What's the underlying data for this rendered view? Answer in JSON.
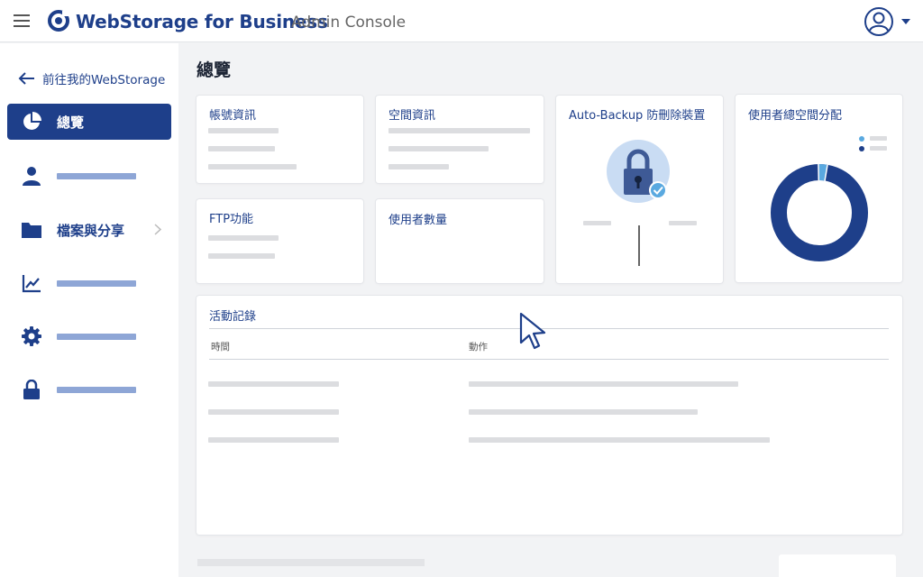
{
  "header": {
    "brand": "WebStorage for Business",
    "subtitle": "Admin Console",
    "menu_icon": "hamburger-icon",
    "logo_icon": "webstorage-logo-icon",
    "user_icon": "user-account-icon",
    "dropdown_icon": "caret-down-icon"
  },
  "sidebar": {
    "back_label": "前往我的WebStorage",
    "items": [
      {
        "label": "總覽",
        "icon": "pie-chart-icon",
        "active": true
      },
      {
        "label": "",
        "icon": "user-icon"
      },
      {
        "label": "檔案與分享",
        "icon": "folder-icon",
        "has_submenu": true
      },
      {
        "label": "",
        "icon": "line-chart-icon"
      },
      {
        "label": "",
        "icon": "gear-icon"
      },
      {
        "label": "",
        "icon": "lock-icon"
      }
    ]
  },
  "main": {
    "title": "總覽",
    "cards": {
      "account": {
        "title": "帳號資訊"
      },
      "space": {
        "title": "空間資訊"
      },
      "backup": {
        "title": "Auto-Backup 防刪除裝置",
        "icon": "lock-check-icon"
      },
      "allocation": {
        "title": "使用者總空間分配",
        "used_fraction": 0.03
      },
      "ftp": {
        "title": "FTP功能"
      },
      "users": {
        "title": "使用者數量"
      }
    },
    "activity": {
      "title": "活動記錄",
      "columns": [
        "時間",
        "動作"
      ]
    }
  },
  "colors": {
    "primary": "#1e3f8a",
    "accent_light": "#5aa9e0",
    "placeholder": "#dcdde0",
    "background": "#f2f3f5"
  }
}
